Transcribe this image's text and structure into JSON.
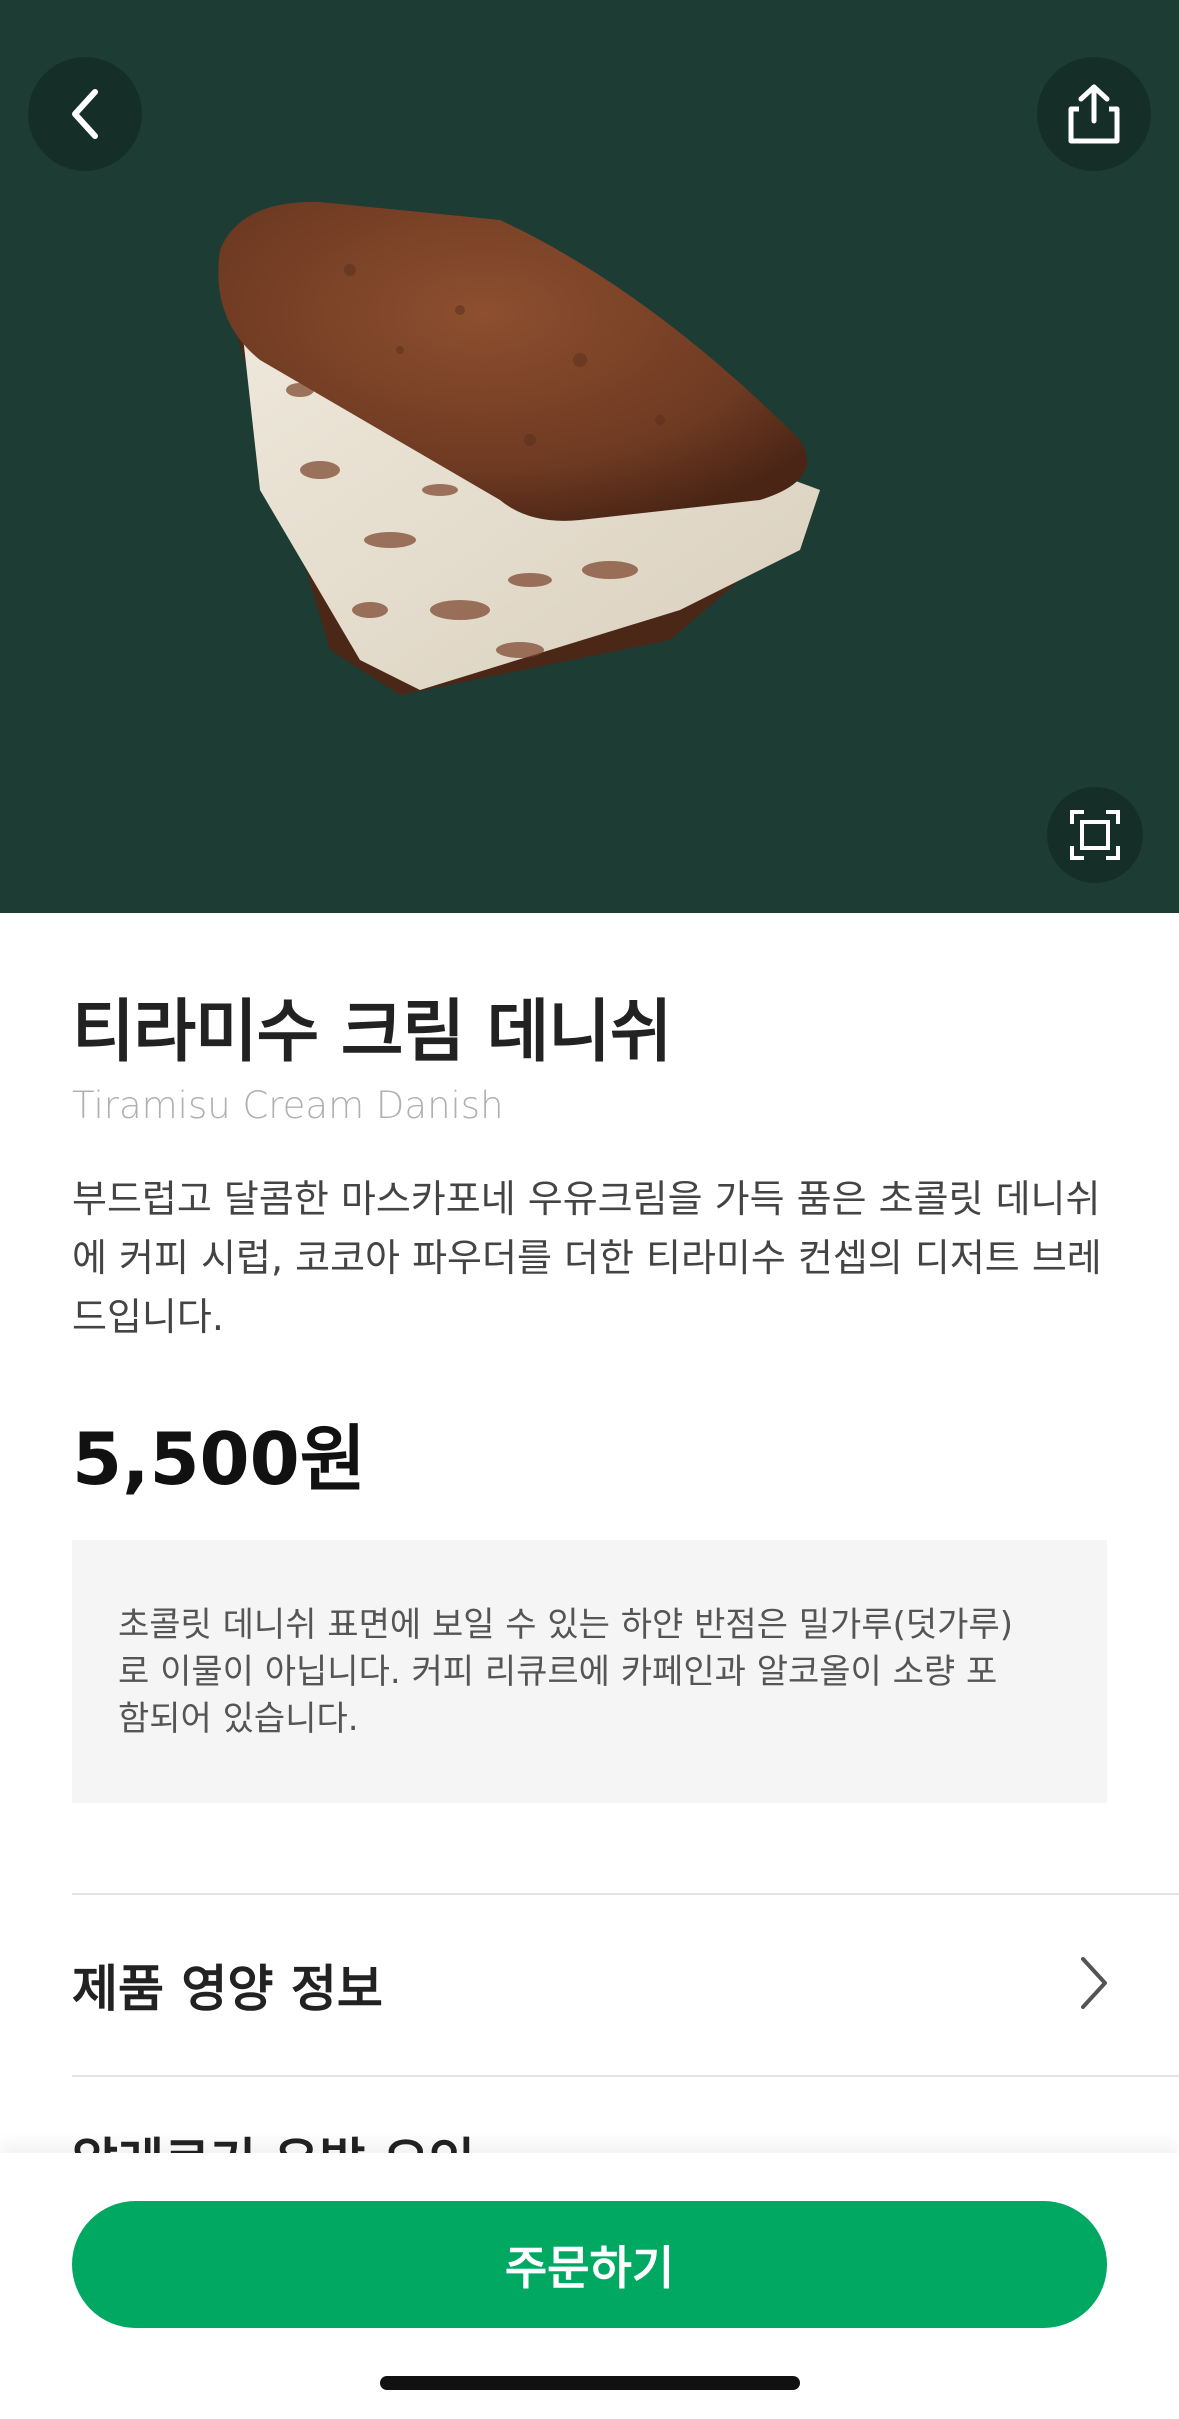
{
  "hero": {
    "background": "#1d3c34",
    "back_icon": "chevron-left-icon",
    "share_icon": "share-icon",
    "expand_icon": "expand-icon"
  },
  "product": {
    "name_ko": "티라미수 크림 데니쉬",
    "name_en": "Tiramisu Cream Danish",
    "description": "부드럽고 달콤한 마스카포네 우유크림을 가득 품은 초콜릿 데니쉬에 커피 시럽, 코코아 파우더를 더한 티라미수 컨셉의 디저트 브레드입니다.",
    "price": "5,500원",
    "notice": "초콜릿 데니쉬 표면에 보일 수 있는 하얀 반점은 밀가루(덧가루)로 이물이 아닙니다. 커피 리큐르에 카페인과 알코올이 소량 포함되어 있습니다."
  },
  "sections": [
    {
      "label": "제품 영양 정보",
      "icon": "chevron-right-icon"
    },
    {
      "label": "알레르기 유발 요인"
    }
  ],
  "order": {
    "label": "주문하기",
    "color": "#00a862"
  }
}
